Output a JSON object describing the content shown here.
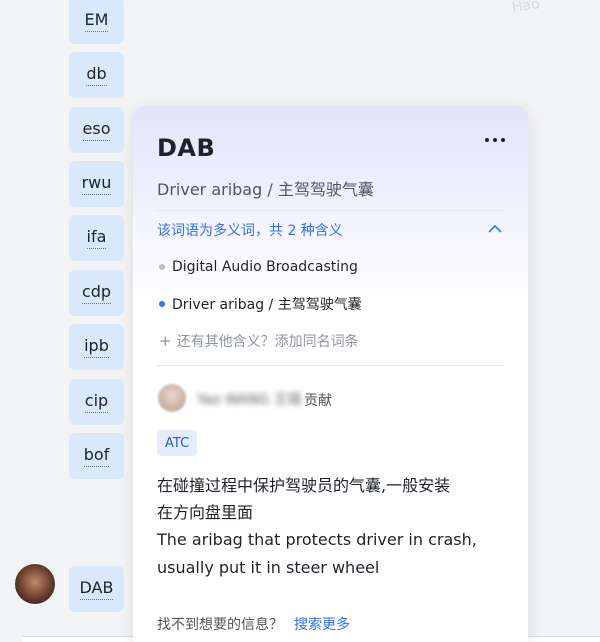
{
  "watermark": "Hao",
  "terms": [
    "EM",
    "db",
    "eso",
    "rwu",
    "ifa",
    "cdp",
    "ipb",
    "cip",
    "bof"
  ],
  "active_term": "DAB",
  "card": {
    "title": "DAB",
    "subtitle": "Driver aribag / 主驾驾驶气囊",
    "polysemy_note": "该词语为多义词，共 2 种含义",
    "meanings": [
      {
        "label": "Digital Audio Broadcasting",
        "dot_color": "#bbbfc4"
      },
      {
        "label": "Driver aribag / 主驾驾驶气囊",
        "dot_color": "#3370ff"
      }
    ],
    "add_meaning": "还有其他含义？添加同名词条",
    "contributor_name": "Yao WANG 王瑶",
    "contributor_suffix": "贡献",
    "tag": "ATC",
    "description_lines": [
      "在碰撞过程中保护驾驶员的气囊,一般安装",
      "在方向盘里面",
      "The aribag that protects driver in crash,",
      "usually put it in steer wheel"
    ],
    "footer_question": "找不到想要的信息？",
    "footer_link": "搜索更多"
  }
}
